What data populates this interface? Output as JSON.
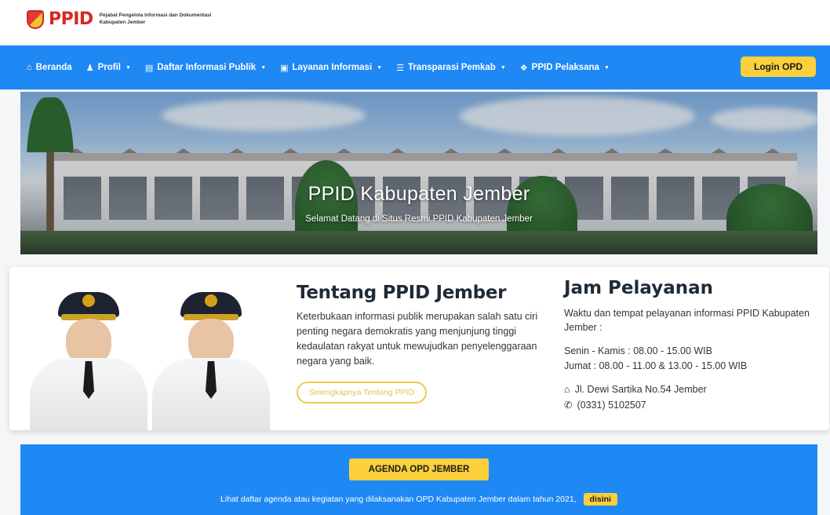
{
  "brand": {
    "name": "PPID",
    "subtitle_line1": "Pejabat Pengelola Informasi dan Dokumentasi",
    "subtitle_line2": "Kabupaten Jember"
  },
  "nav": {
    "items": [
      {
        "label": "Beranda",
        "icon": "home-icon"
      },
      {
        "label": "Profil",
        "icon": "user-icon"
      },
      {
        "label": "Daftar Informasi Publik",
        "icon": "book-icon"
      },
      {
        "label": "Layanan Informasi",
        "icon": "info-icon"
      },
      {
        "label": "Transparasi Pemkab",
        "icon": "list-icon"
      },
      {
        "label": "PPID Pelaksana",
        "icon": "handshake-icon"
      }
    ],
    "login_label": "Login OPD"
  },
  "hero": {
    "title": "PPID Kabupaten Jember",
    "subtitle": "Selamat Datang di Situs Resmi PPID Kabupaten Jember"
  },
  "about": {
    "heading": "Tentang PPID Jember",
    "text": "Keterbukaan informasi publik merupakan salah satu ciri penting negara demokratis yang menjunjung tinggi kedaulatan rakyat untuk mewujudkan penyelenggaraan negara yang baik.",
    "button_label": "Selengkapnya Tentang PPID"
  },
  "hours": {
    "heading": "Jam Pelayanan",
    "description": "Waktu dan tempat pelayanan informasi PPID Kabupaten Jember :",
    "schedule_1": "Senin - Kamis : 08.00 - 15.00 WIB",
    "schedule_2": "Jumat : 08.00 - 11.00 & 13.00 - 15.00 WIB",
    "address": "Jl. Dewi Sartika No.54 Jember",
    "phone": "(0331) 5102507"
  },
  "agenda": {
    "button_label": "AGENDA OPD JEMBER",
    "text": "Lihat daftar agenda atau kegiatan yang dilaksanakan OPD Kabupaten Jember dalam tahun 2021,",
    "link_label": "disini"
  },
  "colors": {
    "nav_blue": "#1e88f5",
    "accent_yellow": "#fbd03c",
    "brand_red": "#d8281f"
  }
}
